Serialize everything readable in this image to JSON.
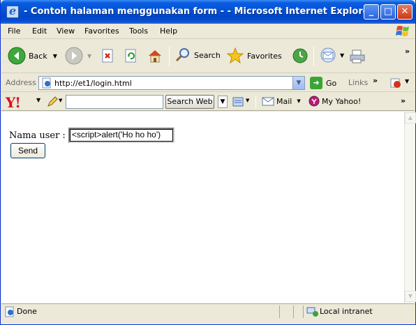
{
  "window": {
    "title": "- Contoh halaman menggunakan form - - Microsoft Internet Explorer"
  },
  "title_buttons": {
    "minimize": "_",
    "maximize": "□",
    "close": "✕"
  },
  "menu": {
    "items": [
      "File",
      "Edit",
      "View",
      "Favorites",
      "Tools",
      "Help"
    ]
  },
  "toolbar": {
    "back_label": "Back",
    "search_label": "Search",
    "favorites_label": "Favorites",
    "chevron": "»"
  },
  "address": {
    "label": "Address",
    "url": "http://et1/login.html",
    "go_label": "Go",
    "links_label": "Links",
    "chevron": "»"
  },
  "yahoo": {
    "logo": "Y!",
    "search_placeholder": "",
    "search_button": "Search Web",
    "mail_label": "Mail",
    "my_yahoo_label": "My Yahoo!",
    "chevron": "»"
  },
  "page": {
    "nama_label": "Nama user :",
    "user_value": "<script>alert('Ho ho ho')",
    "send_label": "Send"
  },
  "status": {
    "text": "Done",
    "zone": "Local intranet"
  },
  "colors": {
    "titlebar": "#0453d8",
    "chrome": "#ece9d8",
    "yahoo_red": "#d3101f"
  },
  "icons": [
    "ie-icon",
    "minimize-icon",
    "maximize-icon",
    "close-icon",
    "windows-logo-icon",
    "back-arrow-icon",
    "forward-arrow-icon",
    "stop-icon",
    "refresh-icon",
    "home-icon",
    "search-icon",
    "favorites-star-icon",
    "history-icon",
    "mail-icon",
    "print-icon",
    "page-icon",
    "go-arrow-icon",
    "yahoo-logo-icon",
    "pencil-icon",
    "mail-envelope-icon",
    "my-yahoo-icon",
    "done-page-icon",
    "local-intranet-icon"
  ]
}
